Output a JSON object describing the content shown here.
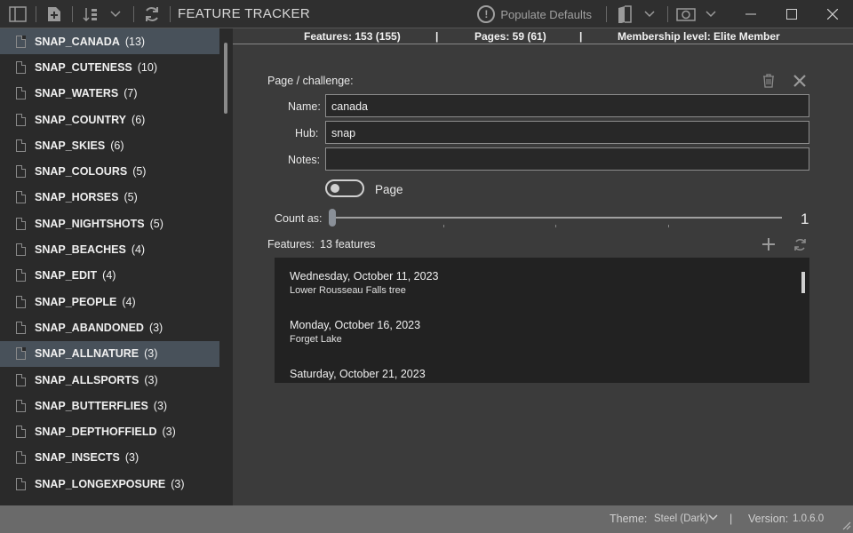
{
  "titlebar": {
    "title": "FEATURE TRACKER",
    "populate_label": "Populate Defaults",
    "icons": [
      "sidebar-toggle-icon",
      "add-page-icon",
      "sort-icon",
      "chevron-down-icon",
      "refresh-icon",
      "alert-icon",
      "book-icon",
      "chevron-down-icon",
      "camera-icon",
      "chevron-down-icon"
    ]
  },
  "sidebar": {
    "items": [
      {
        "name": "SNAP_CANADA",
        "count": "(13)",
        "selected": true
      },
      {
        "name": "SNAP_CUTENESS",
        "count": "(10)"
      },
      {
        "name": "SNAP_WATERS",
        "count": "(7)"
      },
      {
        "name": "SNAP_COUNTRY",
        "count": "(6)"
      },
      {
        "name": "SNAP_SKIES",
        "count": "(6)"
      },
      {
        "name": "SNAP_COLOURS",
        "count": "(5)"
      },
      {
        "name": "SNAP_HORSES",
        "count": "(5)"
      },
      {
        "name": "SNAP_NIGHTSHOTS",
        "count": "(5)"
      },
      {
        "name": "SNAP_BEACHES",
        "count": "(4)"
      },
      {
        "name": "SNAP_EDIT",
        "count": "(4)"
      },
      {
        "name": "SNAP_PEOPLE",
        "count": "(4)"
      },
      {
        "name": "SNAP_ABANDONED",
        "count": "(3)"
      },
      {
        "name": "SNAP_ALLNATURE",
        "count": "(3)",
        "selected": true
      },
      {
        "name": "SNAP_ALLSPORTS",
        "count": "(3)"
      },
      {
        "name": "SNAP_BUTTERFLIES",
        "count": "(3)"
      },
      {
        "name": "SNAP_DEPTHOFFIELD",
        "count": "(3)"
      },
      {
        "name": "SNAP_INSECTS",
        "count": "(3)"
      },
      {
        "name": "SNAP_LONGEXPOSURE",
        "count": "(3)"
      }
    ]
  },
  "stats": {
    "features": "Features: 153 (155)",
    "sep1": "|",
    "pages": "Pages: 59 (61)",
    "sep2": "|",
    "membership": "Membership level: Elite Member"
  },
  "editor": {
    "section_title": "Page / challenge:",
    "name_label": "Name:",
    "name_value": "canada",
    "hub_label": "Hub:",
    "hub_value": "snap",
    "notes_label": "Notes:",
    "notes_value": "",
    "page_toggle_label": "Page",
    "count_as_label": "Count as:",
    "count_as_value": "1",
    "features_label": "Features:",
    "features_count": "13 features"
  },
  "features": [
    {
      "date": "Wednesday, October 11, 2023",
      "name": "Lower Rousseau Falls tree"
    },
    {
      "date": "Monday, October 16, 2023",
      "name": "Forget Lake"
    },
    {
      "date": "Saturday, October 21, 2023",
      "name": ""
    }
  ],
  "statusbar": {
    "theme_label": "Theme:",
    "theme_value": "Steel (Dark)",
    "sep": "|",
    "version_label": "Version:",
    "version_value": "1.0.6.0"
  }
}
